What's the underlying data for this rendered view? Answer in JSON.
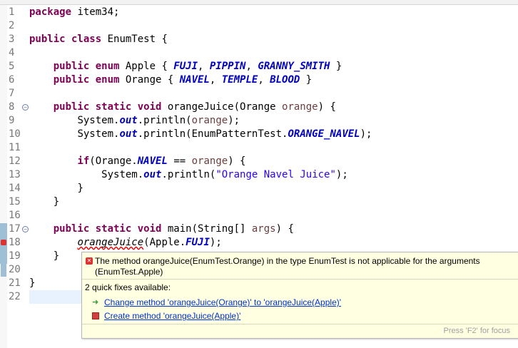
{
  "editor": {
    "lines": [
      {
        "n": "1"
      },
      {
        "n": "2"
      },
      {
        "n": "3"
      },
      {
        "n": "4"
      },
      {
        "n": "5"
      },
      {
        "n": "6"
      },
      {
        "n": "7"
      },
      {
        "n": "8"
      },
      {
        "n": "9"
      },
      {
        "n": "10"
      },
      {
        "n": "11"
      },
      {
        "n": "12"
      },
      {
        "n": "13"
      },
      {
        "n": "14"
      },
      {
        "n": "15"
      },
      {
        "n": "16"
      },
      {
        "n": "17"
      },
      {
        "n": "18"
      },
      {
        "n": "19"
      },
      {
        "n": "20"
      },
      {
        "n": "21"
      },
      {
        "n": "22"
      }
    ],
    "code": {
      "l1_kw": "package",
      "l1_rest": " item34;",
      "l3_kw": "public class",
      "l3_rest": " EnumTest {",
      "l5_kw": "public enum",
      "l5_a": " Apple { ",
      "l5_c1": "FUJI",
      ", ": ", ",
      "l5_c2": "PIPPIN",
      "l5_c3": "GRANNY_SMITH",
      "l5_end": " }",
      "l6_kw": "public enum",
      "l6_a": " Orange { ",
      "l6_c1": "NAVEL",
      "l6_c2": "TEMPLE",
      "l6_c3": "BLOOD",
      "l6_end": " }",
      "l8_kw": "public static void",
      "l8_a": " orangeJuice(Orange ",
      "l8_p": "orange",
      "l8_end": ") {",
      "l9_a": "System.",
      "l9_out": "out",
      "l9_b": ".println(",
      "l9_p": "orange",
      "l9_end": ");",
      "l10_a": "System.",
      "l10_out": "out",
      "l10_b": ".println(EnumPatternTest.",
      "l10_c": "ORANGE_NAVEL",
      "l10_end": ");",
      "l12_kw": "if",
      "l12_a": "(Orange.",
      "l12_c": "NAVEL",
      "l12_b": " == ",
      "l12_p": "orange",
      "l12_end": ") {",
      "l13_a": "System.",
      "l13_out": "out",
      "l13_b": ".println(",
      "l13_s": "\"Orange Navel Juice\"",
      "l13_end": ");",
      "l14": "}",
      "l15": "}",
      "l17_kw": "public static void",
      "l17_a": " main(String[] ",
      "l17_p": "args",
      "l17_end": ") {",
      "l18_err": "orangeJuice",
      "l18_a": "(Apple.",
      "l18_c": "FUJI",
      "l18_end": ");",
      "l19": "}",
      "l21": "}"
    }
  },
  "popup": {
    "message": "The method orangeJuice(EnumTest.Orange) in the type EnumTest is not applicable for the arguments (EnumTest.Apple)",
    "fixes_header": "2 quick fixes available:",
    "fixes": [
      {
        "label": "Change method 'orangeJuice(Orange)' to 'orangeJuice(Apple)'",
        "icon": "change-method-icon"
      },
      {
        "label": "Create method 'orangeJuice(Apple)'",
        "icon": "create-method-icon"
      }
    ],
    "hint": "Press 'F2' for focus"
  },
  "colors": {
    "keyword": "#7f0055",
    "enum_constant": "#0000c0",
    "string": "#2a00ff",
    "parameter": "#6a3e3e",
    "error": "#e00000",
    "popup_bg": "#ffffe1"
  }
}
